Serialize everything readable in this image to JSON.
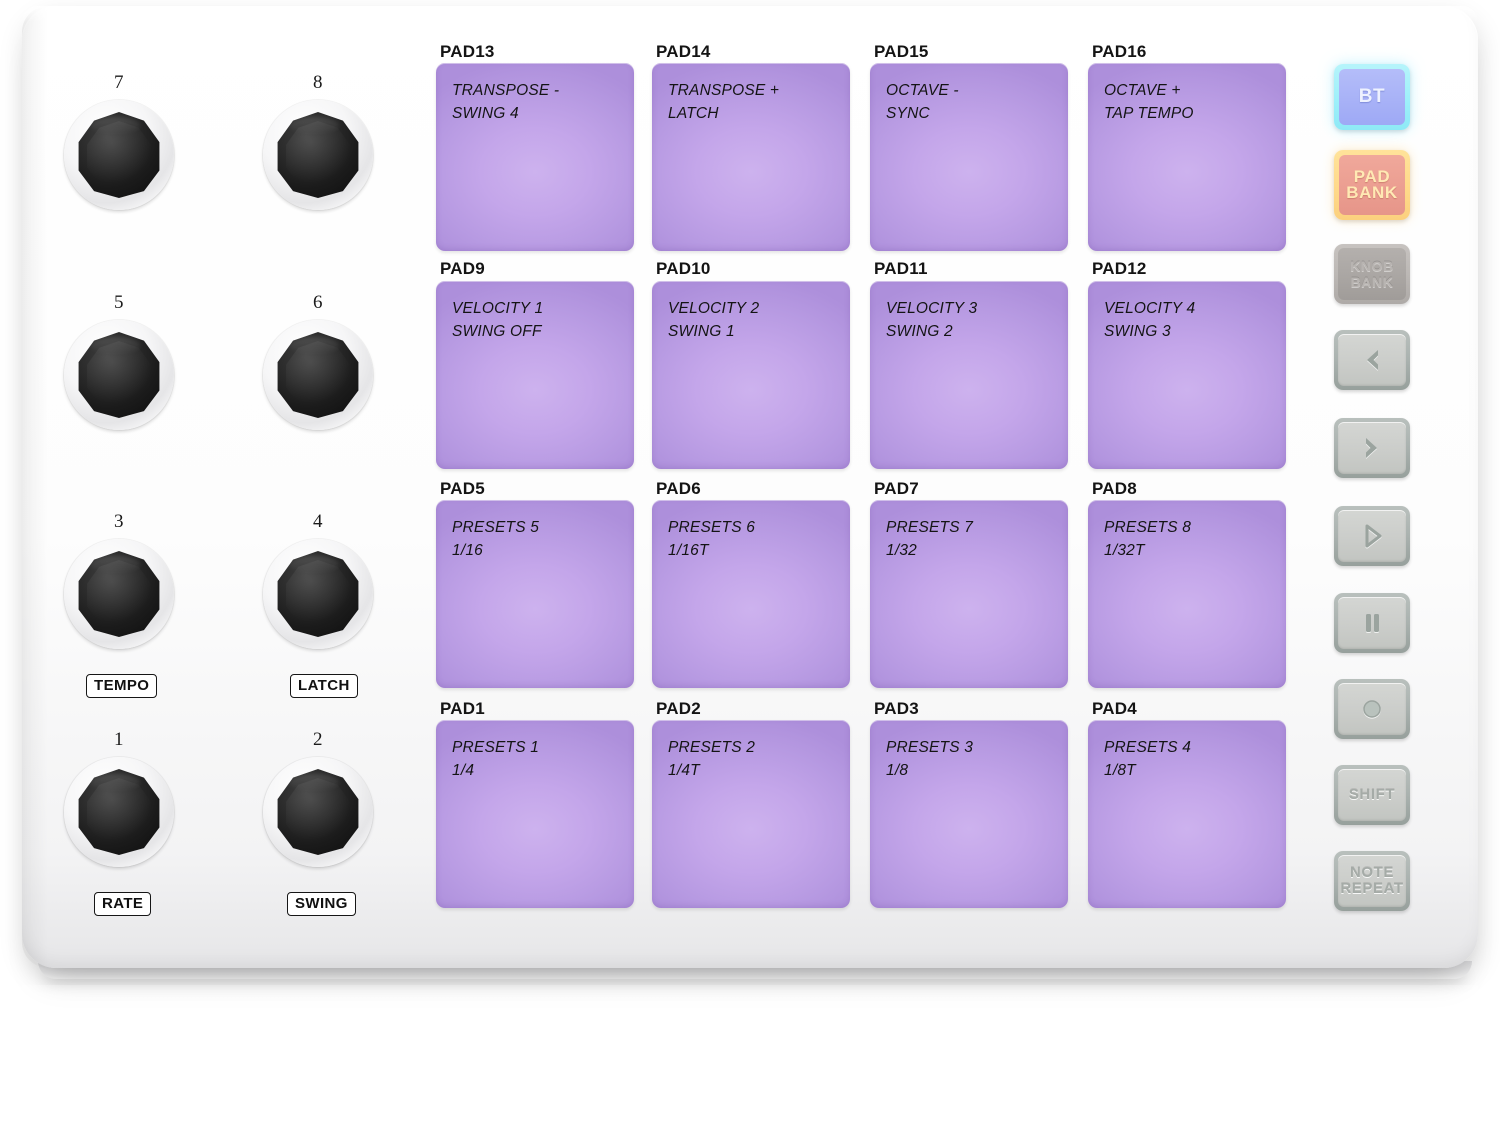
{
  "device": {
    "name": "midi-pad-controller",
    "body_color": "#ffffff",
    "pad_color": "#bb9ce4",
    "bt_color": "#a8b2f7",
    "pad_bank_color": "#eb9e91",
    "knob_color": "#1b1b1b"
  },
  "knobs": [
    {
      "number": "7",
      "label": ""
    },
    {
      "number": "8",
      "label": ""
    },
    {
      "number": "5",
      "label": ""
    },
    {
      "number": "6",
      "label": ""
    },
    {
      "number": "3",
      "label": "TEMPO"
    },
    {
      "number": "4",
      "label": "LATCH"
    },
    {
      "number": "1",
      "label": "RATE"
    },
    {
      "number": "2",
      "label": "SWING"
    }
  ],
  "pads": [
    {
      "id": "PAD13",
      "line1": "TRANSPOSE -",
      "line2": "SWING 4"
    },
    {
      "id": "PAD14",
      "line1": "TRANSPOSE +",
      "line2": "LATCH"
    },
    {
      "id": "PAD15",
      "line1": "OCTAVE -",
      "line2": "SYNC"
    },
    {
      "id": "PAD16",
      "line1": "OCTAVE +",
      "line2": "TAP TEMPO"
    },
    {
      "id": "PAD9",
      "line1": "VELOCITY 1",
      "line2": "SWING OFF"
    },
    {
      "id": "PAD10",
      "line1": "VELOCITY 2",
      "line2": "SWING 1"
    },
    {
      "id": "PAD11",
      "line1": "VELOCITY 3",
      "line2": "SWING 2"
    },
    {
      "id": "PAD12",
      "line1": "VELOCITY 4",
      "line2": "SWING 3"
    },
    {
      "id": "PAD5",
      "line1": "PRESETS 5",
      "line2": "1/16"
    },
    {
      "id": "PAD6",
      "line1": "PRESETS 6",
      "line2": "1/16T"
    },
    {
      "id": "PAD7",
      "line1": "PRESETS 7",
      "line2": "1/32"
    },
    {
      "id": "PAD8",
      "line1": "PRESETS 8",
      "line2": "1/32T"
    },
    {
      "id": "PAD1",
      "line1": "PRESETS 1",
      "line2": "1/4"
    },
    {
      "id": "PAD2",
      "line1": "PRESETS 2",
      "line2": "1/4T"
    },
    {
      "id": "PAD3",
      "line1": "PRESETS 3",
      "line2": "1/8"
    },
    {
      "id": "PAD4",
      "line1": "PRESETS 4",
      "line2": "1/8T"
    }
  ],
  "side_buttons": [
    {
      "name": "bt-button",
      "label": "BT",
      "icon": "bluetooth-icon",
      "type": "bt"
    },
    {
      "name": "pad-bank-button",
      "label1": "PAD",
      "label2": "BANK",
      "icon": "pad-bank-icon",
      "type": "padbank"
    },
    {
      "name": "knob-bank-button",
      "label1": "KNOB",
      "label2": "BANK",
      "icon": "knob-bank-icon",
      "type": "knobbank"
    },
    {
      "name": "prev-button",
      "label": "",
      "icon": "chevron-left-icon",
      "type": "grey"
    },
    {
      "name": "next-button",
      "label": "",
      "icon": "chevron-right-icon",
      "type": "grey"
    },
    {
      "name": "play-button",
      "label": "",
      "icon": "play-icon",
      "type": "grey"
    },
    {
      "name": "pause-button",
      "label": "",
      "icon": "pause-icon",
      "type": "grey"
    },
    {
      "name": "record-button",
      "label": "",
      "icon": "record-icon",
      "type": "grey"
    },
    {
      "name": "shift-button",
      "label": "SHIFT",
      "icon": "shift-icon",
      "type": "grey"
    },
    {
      "name": "note-repeat-button",
      "label1": "NOTE",
      "label2": "REPEAT",
      "icon": "note-repeat-icon",
      "type": "grey"
    }
  ]
}
